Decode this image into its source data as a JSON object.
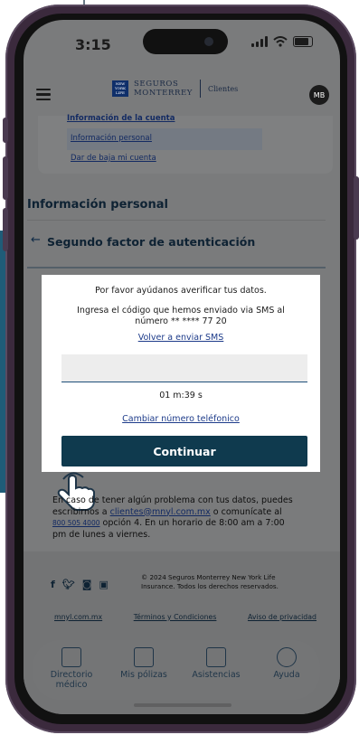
{
  "status": {
    "time": "3:15"
  },
  "header": {
    "logo_box": "NEW YORK LIFE",
    "brand_line1": "SEGUROS",
    "brand_line2": "MONTERREY",
    "brand_sub": "Clientes",
    "avatar_initials": "MB"
  },
  "account_card": {
    "heading_link": "Información de la cuenta",
    "links": [
      "Información personal",
      "Dar de baja mi cuenta"
    ]
  },
  "section_title": "Información personal",
  "twofa": {
    "back_icon": "arrow-left-icon",
    "title": "Segundo factor de autenticación"
  },
  "modal": {
    "text1": "Por favor ayúdanos averificar tus datos.",
    "text2_line1": "Ingresa el código que hemos enviado via SMS al",
    "text2_line2": "número ** **** 77 20",
    "resend_link": "Volver a enviar SMS",
    "input_value": "",
    "timer": "01 m:39 s",
    "change_number_link": "Cambiar número teléfonico",
    "continue_button": "Continuar"
  },
  "help": {
    "line1": "En caso de tener algún problema con tus datos, puedes",
    "line2_a": "escribirnos a ",
    "email": "clientes@mnyl.com.mx",
    "line2_b": " o comunícate al",
    "phone": "800 505 4000",
    "line3_b": " opción 4. En un horario de 8:00 am a 7:00",
    "line4": "pm de lunes a viernes."
  },
  "footer": {
    "social_icons": [
      "facebook-icon",
      "twitter-icon",
      "instagram-icon",
      "linkedin-icon"
    ],
    "copyright_line1": "© 2024 Seguros Monterrey New York Life",
    "copyright_line2": "Insurance. Todos los derechos reservados.",
    "links": [
      "mnyl.com.mx",
      "Términos y Condiciones",
      "Aviso de privacidad"
    ]
  },
  "tabs": [
    {
      "label_line1": "Directorio",
      "label_line2": "médico",
      "icon": "medical-directory-icon"
    },
    {
      "label_line1": "Mis pólizas",
      "label_line2": "",
      "icon": "policies-icon"
    },
    {
      "label_line1": "Asistencias",
      "label_line2": "",
      "icon": "assistance-icon"
    },
    {
      "label_line1": "Ayuda",
      "label_line2": "",
      "icon": "help-icon"
    }
  ],
  "colors": {
    "primary": "#0f3a4e",
    "link": "#1d3b8a",
    "overlay": "#7a7b7c",
    "brand": "#0f2f6a"
  }
}
